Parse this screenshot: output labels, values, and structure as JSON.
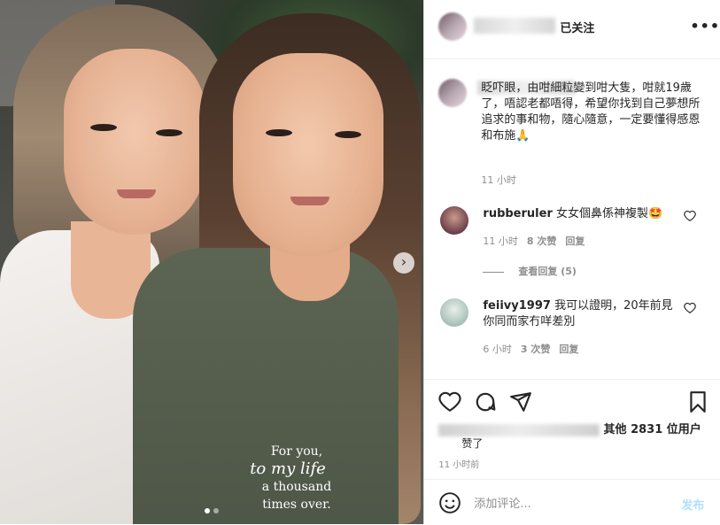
{
  "post": {
    "follow_label": "已关注",
    "more_label": "•••",
    "caption": "眨吓眼，由咁細粒變到咁大隻，咁就19歲了，唔認老都唔得，希望你找到自己夢想所追求的事和物，隨心隨意，一定要懂得感恩和布施🙏",
    "caption_time": "11 小时"
  },
  "photo": {
    "overlay_line1": "For you,",
    "overlay_line2": "to my life",
    "overlay_line3": "a thousand",
    "overlay_line4": "times over.",
    "next_icon": "›"
  },
  "comments": [
    {
      "user": "rubberuler",
      "text": "女女個鼻係神複製🤩",
      "time": "11 小时",
      "likes": "8 次赞",
      "reply": "回复",
      "avatar_color": "#7a4a5a"
    },
    {
      "user": "feiivy1997",
      "text": "我可以證明，20年前見你同而家冇咩差別",
      "time": "6 小时",
      "likes": "3 次赞",
      "reply": "回复",
      "avatar_color": "#9fb9b3"
    }
  ],
  "view_replies": "查看回复 (5)",
  "likes": {
    "prefix_tail": "其他 2831 位用户",
    "suffix": "赞了"
  },
  "posted_time": "11 小时前",
  "comment_box": {
    "placeholder": "添加评论...",
    "post_label": "发布"
  }
}
